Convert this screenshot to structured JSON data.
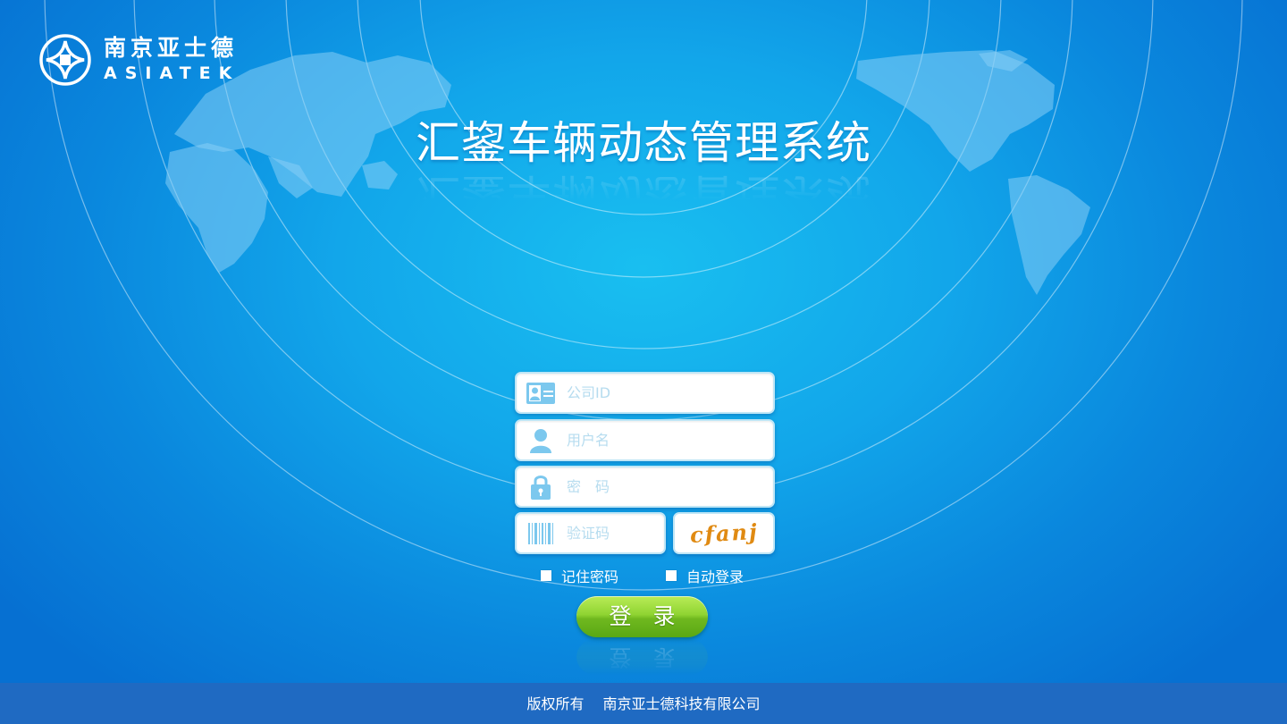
{
  "brand": {
    "name_cn": "南京亚士德",
    "name_en": "ASIATEK"
  },
  "app": {
    "title": "汇鋆车辆动态管理系统"
  },
  "login_form": {
    "company_id_placeholder": "公司ID",
    "username_placeholder": "用户名",
    "password_placeholder": "密　码",
    "captcha_placeholder": "验证码",
    "captcha_text": "cfanj",
    "remember_password_label": "记住密码",
    "auto_login_label": "自动登录",
    "login_button_label": "登 录"
  },
  "footer": {
    "copyright": "版权所有",
    "company": "南京亚士德科技有限公司"
  },
  "colors": {
    "background_center": "#19bff0",
    "background_edge": "#0670d2",
    "footer_bar": "#1f6ac2",
    "login_button": "#8fd432",
    "captcha_text": "#e08a12"
  },
  "icons": [
    "logo-mark-icon",
    "id-card-icon",
    "user-icon",
    "lock-icon",
    "barcode-icon"
  ]
}
